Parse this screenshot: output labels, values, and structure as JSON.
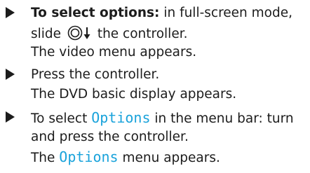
{
  "steps": [
    {
      "bold_lead": "To select options:",
      "line1_rest": " in full-screen mode,",
      "line2_before": "slide",
      "line2_icon": "controller-slide-down-icon",
      "line2_after": " the controller.",
      "result": "The video menu appears."
    },
    {
      "line1": "Press the controller.",
      "result": "The DVD basic display appears."
    },
    {
      "line1_before": "To select ",
      "line1_ui": "Options",
      "line1_after": " in the menu bar: turn",
      "line2": "and press the controller.",
      "result_before": "The ",
      "result_ui": "Options",
      "result_after": " menu appears."
    }
  ],
  "colors": {
    "ui_term": "#1aa3db",
    "text": "#1c1c1c"
  }
}
